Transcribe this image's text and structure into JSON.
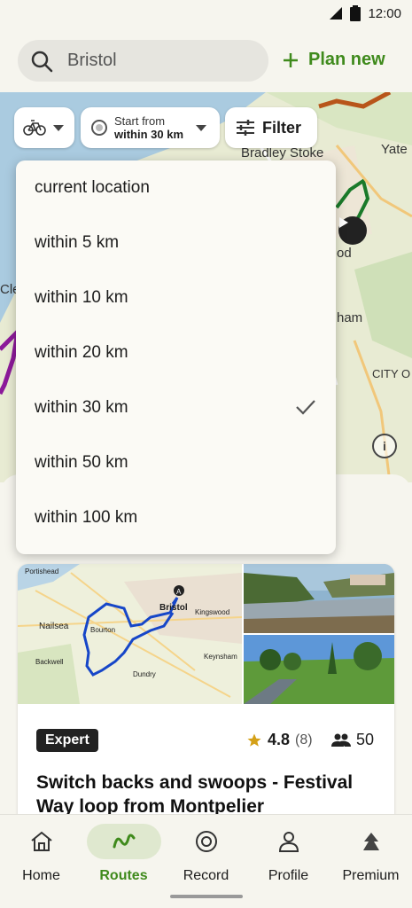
{
  "status_bar": {
    "time": "12:00"
  },
  "search": {
    "value": "Bristol"
  },
  "plan_new": {
    "label": "Plan new"
  },
  "map": {
    "labels": [
      "Bradley Stoke",
      "Yate",
      "od",
      "ham",
      "CITY O",
      "Cle"
    ]
  },
  "filters": {
    "start_from_label": "Start from",
    "start_from_value": "within 30 km",
    "filter_label": "Filter"
  },
  "dropdown": {
    "options": [
      "current location",
      "within 5 km",
      "within 10 km",
      "within 20 km",
      "within 30 km",
      "within 50 km",
      "within 100 km"
    ],
    "selected": "within 30 km"
  },
  "route_card": {
    "difficulty": "Expert",
    "rating": "4.8",
    "rating_count": "(8)",
    "people": "50",
    "title": "Switch backs and swoops - Festival Way loop from Montpelier",
    "map_labels": [
      "Portishead",
      "Bristol",
      "Nailsea",
      "Backwell",
      "Kingswood",
      "Keynsham",
      "Dundry",
      "Bourton"
    ]
  },
  "bottom_nav": {
    "items": [
      "Home",
      "Routes",
      "Record",
      "Profile",
      "Premium"
    ],
    "active": "Routes"
  },
  "colors": {
    "accent": "#3f8a1c",
    "route_blue": "#1646c8"
  }
}
